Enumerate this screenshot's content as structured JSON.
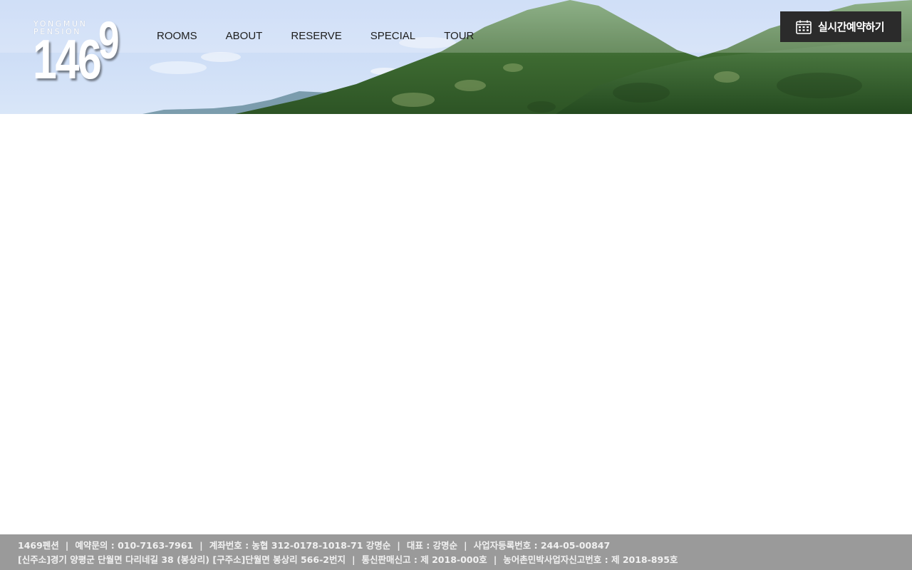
{
  "logo": {
    "small_line1": "YONGMUN",
    "small_line2": "PENSION",
    "number_main": "146",
    "number_sup": "9"
  },
  "nav": {
    "items": [
      {
        "label": "ROOMS"
      },
      {
        "label": "ABOUT"
      },
      {
        "label": "RESERVE"
      },
      {
        "label": "SPECIAL"
      },
      {
        "label": "TOUR"
      }
    ]
  },
  "reserve_button": {
    "label": "실시간예약하기",
    "icon": "calendar-icon"
  },
  "footer": {
    "line1": [
      "1469펜션",
      "예약문의 : 010-7163-7961",
      "계좌번호 : 농협 312-0178-1018-71 강명순",
      "대표 : 강명순",
      "사업자등록번호 : 244-05-00847"
    ],
    "line2": [
      "[신주소]경기 양평군 단월면 다리네길 38 (봉상리) [구주소]단월면 봉상리 566-2번지",
      "통신판매신고 : 제 2018-000호",
      "농어촌민박사업자신고번호 : 제 2018-895호"
    ],
    "separator": "|"
  },
  "colors": {
    "sky": "#c9dcf6",
    "mountain_green": "#3f6b33",
    "reserve_bg": "#2b2b2b",
    "footer_bg": "#9a9a9a",
    "footer_text": "#f1f1f1",
    "nav_text": "#1d1d1d"
  }
}
